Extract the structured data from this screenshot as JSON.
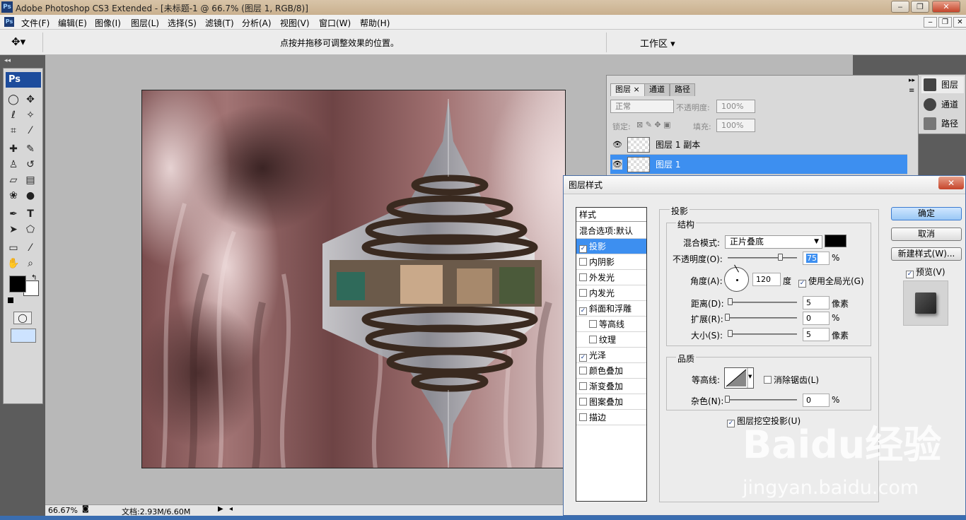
{
  "window": {
    "app_icon": "Ps",
    "title": "Adobe Photoshop CS3 Extended - [未标题-1 @ 66.7% (图层 1, RGB/8)]",
    "controls": [
      "‒",
      "❐",
      "✕"
    ]
  },
  "menubar": {
    "items": [
      "文件(F)",
      "编辑(E)",
      "图像(I)",
      "图层(L)",
      "选择(S)",
      "滤镜(T)",
      "分析(A)",
      "视图(V)",
      "窗口(W)",
      "帮助(H)"
    ],
    "doc_controls": [
      "‒",
      "❐",
      "✕"
    ]
  },
  "options": {
    "tool_icon": "move-icon",
    "tip": "点按并拖移可调整效果的位置。",
    "workspace": "工作区 ▾"
  },
  "toolbox": {
    "logo": "Ps",
    "tools": [
      [
        "marquee-icon",
        "move-icon"
      ],
      [
        "lasso-icon",
        "magic-wand-icon"
      ],
      [
        "crop-icon",
        "eyedropper-slice-icon"
      ],
      [
        "healing-icon",
        "brush-icon"
      ],
      [
        "stamp-icon",
        "history-brush-icon"
      ],
      [
        "eraser-icon",
        "gradient-icon"
      ],
      [
        "blur-icon",
        "dodge-icon"
      ],
      [
        "pen-icon",
        "type-icon"
      ],
      [
        "path-select-icon",
        "shape-icon"
      ],
      [
        "notes-icon",
        "eyedropper-icon"
      ],
      [
        "hand-icon",
        "zoom-icon"
      ]
    ],
    "fg_color": "#000000",
    "bg_color": "#ffffff"
  },
  "status": {
    "zoom": "66.67%",
    "doc": "文档:2.93M/6.60M"
  },
  "dock": {
    "items": [
      "图层",
      "通道",
      "路径"
    ]
  },
  "layers_panel": {
    "tabs": [
      "图层",
      "通道",
      "路径"
    ],
    "blend_mode": "正常",
    "opacity_label": "不透明度:",
    "opacity": "100%",
    "lock_label": "锁定:",
    "fill_label": "填充:",
    "fill": "100%",
    "layers": [
      {
        "name": "图层 1 副本",
        "selected": false
      },
      {
        "name": "图层 1",
        "selected": true
      }
    ]
  },
  "dialog": {
    "title": "图层样式",
    "styles_header": "样式",
    "styles": [
      {
        "label": "混合选项:默认",
        "checkbox": false,
        "checked": false,
        "selected": false,
        "indent": false
      },
      {
        "label": "投影",
        "checkbox": true,
        "checked": true,
        "selected": true,
        "indent": false
      },
      {
        "label": "内阴影",
        "checkbox": true,
        "checked": false,
        "selected": false,
        "indent": false
      },
      {
        "label": "外发光",
        "checkbox": true,
        "checked": false,
        "selected": false,
        "indent": false
      },
      {
        "label": "内发光",
        "checkbox": true,
        "checked": false,
        "selected": false,
        "indent": false
      },
      {
        "label": "斜面和浮雕",
        "checkbox": true,
        "checked": true,
        "selected": false,
        "indent": false
      },
      {
        "label": "等高线",
        "checkbox": true,
        "checked": false,
        "selected": false,
        "indent": true
      },
      {
        "label": "纹理",
        "checkbox": true,
        "checked": false,
        "selected": false,
        "indent": true
      },
      {
        "label": "光泽",
        "checkbox": true,
        "checked": true,
        "selected": false,
        "indent": false
      },
      {
        "label": "颜色叠加",
        "checkbox": true,
        "checked": false,
        "selected": false,
        "indent": false
      },
      {
        "label": "渐变叠加",
        "checkbox": true,
        "checked": false,
        "selected": false,
        "indent": false
      },
      {
        "label": "图案叠加",
        "checkbox": true,
        "checked": false,
        "selected": false,
        "indent": false
      },
      {
        "label": "描边",
        "checkbox": true,
        "checked": false,
        "selected": false,
        "indent": false
      }
    ],
    "section_title": "投影",
    "structure": {
      "title": "结构",
      "blend_label": "混合模式:",
      "blend_value": "正片叠底",
      "color": "#000000",
      "opacity_label": "不透明度(O):",
      "opacity_value": "75",
      "opacity_unit": "%",
      "opacity_fraction": 0.75,
      "angle_label": "角度(A):",
      "angle_value": "120",
      "angle_unit": "度",
      "global_light": "使用全局光(G)",
      "distance_label": "距离(D):",
      "distance_value": "5",
      "distance_unit": "像素",
      "spread_label": "扩展(R):",
      "spread_value": "0",
      "spread_unit": "%",
      "size_label": "大小(S):",
      "size_value": "5",
      "size_unit": "像素"
    },
    "quality": {
      "title": "品质",
      "contour_label": "等高线:",
      "antialias": "消除锯齿(L)",
      "noise_label": "杂色(N):",
      "noise_value": "0",
      "noise_unit": "%",
      "knockout": "图层挖空投影(U)"
    },
    "buttons": {
      "ok": "确定",
      "cancel": "取消",
      "new_style": "新建样式(W)...",
      "preview": "预览(V)"
    }
  },
  "watermark": {
    "brand": "Baidu经验",
    "url": "jingyan.baidu.com"
  }
}
